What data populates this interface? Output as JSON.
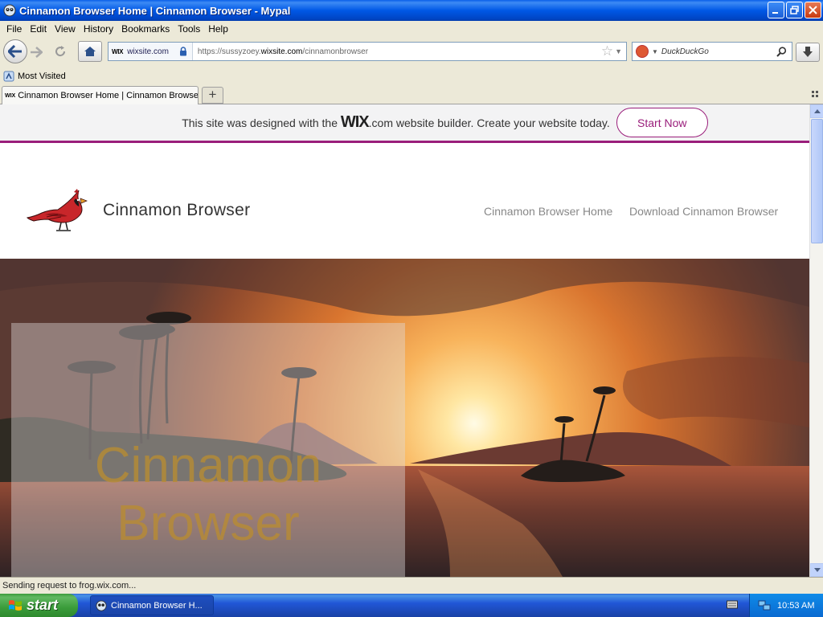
{
  "window": {
    "title": "Cinnamon Browser Home | Cinnamon Browser - Mypal"
  },
  "menu": [
    "File",
    "Edit",
    "View",
    "History",
    "Bookmarks",
    "Tools",
    "Help"
  ],
  "navbar": {
    "identity_logo": "WIX",
    "identity_domain": "wixsite.com",
    "url_prefix": "https://sussyzoey.",
    "url_host": "wixsite.com",
    "url_path": "/cinnamonbrowser",
    "search_engine": "DuckDuckGo"
  },
  "bookmarks": {
    "most_visited": "Most Visited"
  },
  "tabs": {
    "active_label": "Cinnamon Browser Home | Cinnamon Browser",
    "favicon": "WIX",
    "new_tab": "+"
  },
  "wix_banner": {
    "message_before": "This site was designed with the ",
    "brand": "WIX",
    "message_after": ".com website builder. Create your website today.",
    "cta": "Start Now",
    "accent": "#9A1E7B"
  },
  "site": {
    "name": "Cinnamon Browser",
    "nav": [
      "Cinnamon Browser Home",
      "Download Cinnamon Browser"
    ],
    "hero_title": "Cinnamon Browser"
  },
  "status": {
    "text": "Sending request to frog.wix.com..."
  },
  "taskbar": {
    "start": "start",
    "task": "Cinnamon Browser H...",
    "clock": "10:53 AM"
  }
}
